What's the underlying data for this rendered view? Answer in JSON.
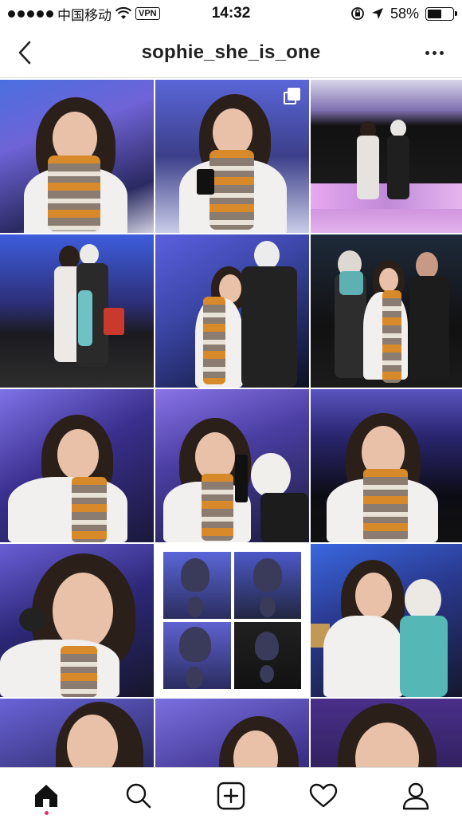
{
  "status_bar": {
    "carrier": "中国移动",
    "vpn": "VPN",
    "time": "14:32",
    "battery": "58%",
    "battery_level": 0.58
  },
  "header": {
    "title": "sophie_she_is_one"
  },
  "grid": {
    "rows": 5,
    "columns": 3,
    "multi_photo_post_index": 1
  },
  "tab_bar": {
    "items": [
      "home",
      "search",
      "add",
      "activity",
      "profile"
    ],
    "active": "home",
    "notification_color": "#e1306c"
  },
  "colors": {
    "accent": "#e1306c",
    "divider": "#dbdbdb",
    "stage_purple": "#6f63d6",
    "scarf_orange": "#d88a2a"
  }
}
